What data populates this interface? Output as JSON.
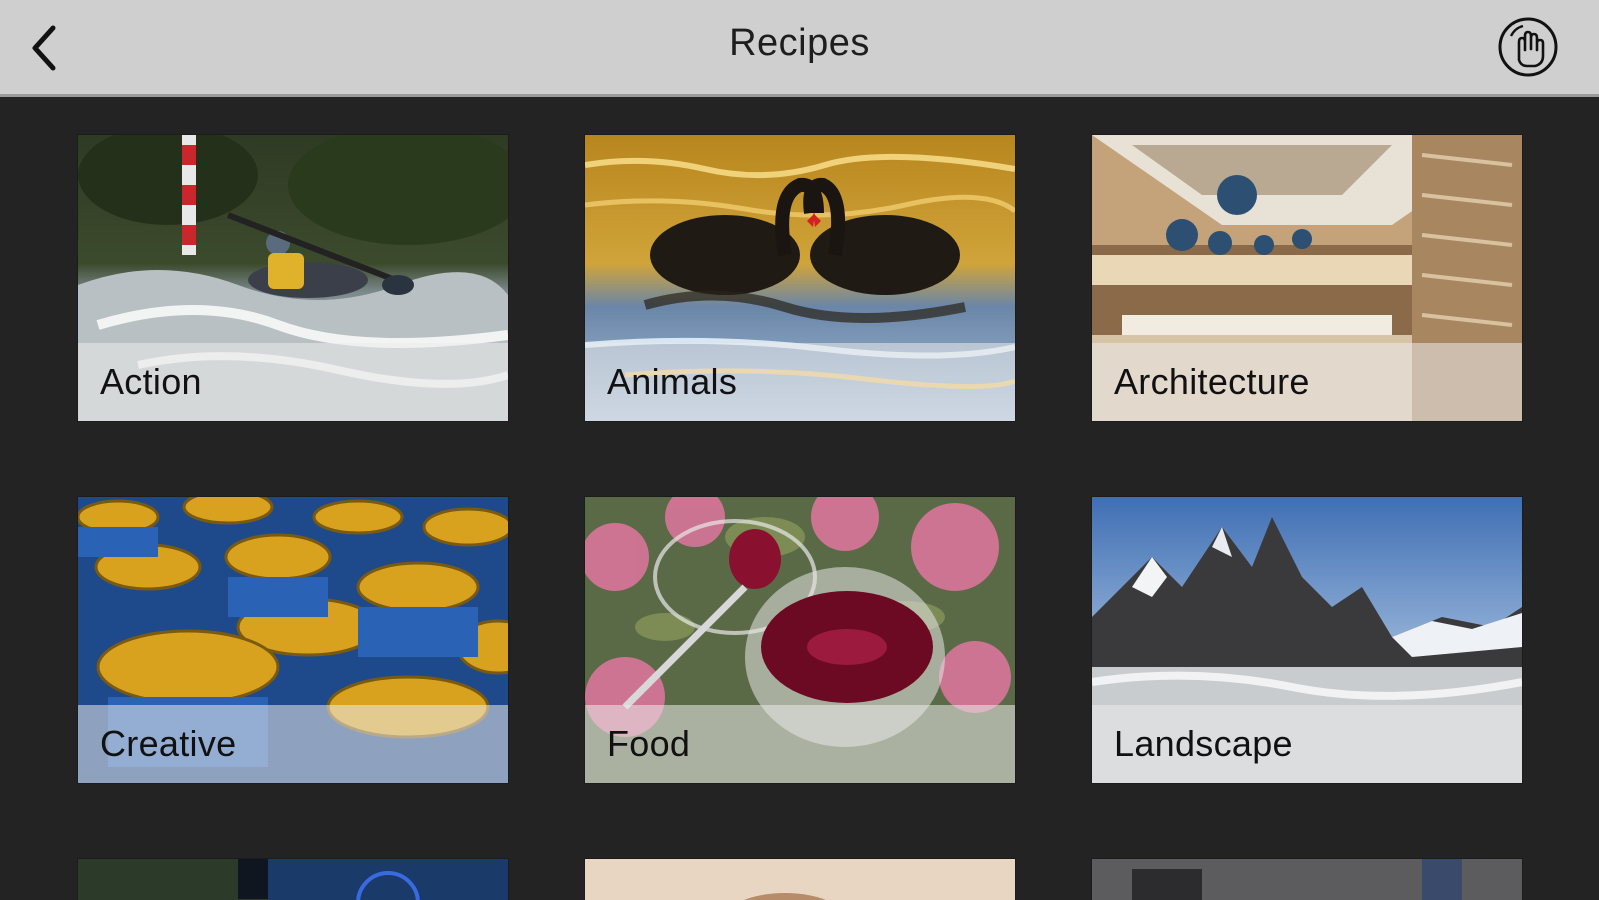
{
  "header": {
    "title": "Recipes",
    "back_icon": "chevron-left-icon",
    "help_icon": "hand-touch-icon"
  },
  "recipes": [
    {
      "label": "Action"
    },
    {
      "label": "Animals"
    },
    {
      "label": "Architecture"
    },
    {
      "label": "Creative"
    },
    {
      "label": "Food"
    },
    {
      "label": "Landscape"
    }
  ],
  "colors": {
    "header_bg": "#cfcfcf",
    "page_bg": "#232323",
    "label_band": "rgba(235,235,235,0.55)"
  }
}
